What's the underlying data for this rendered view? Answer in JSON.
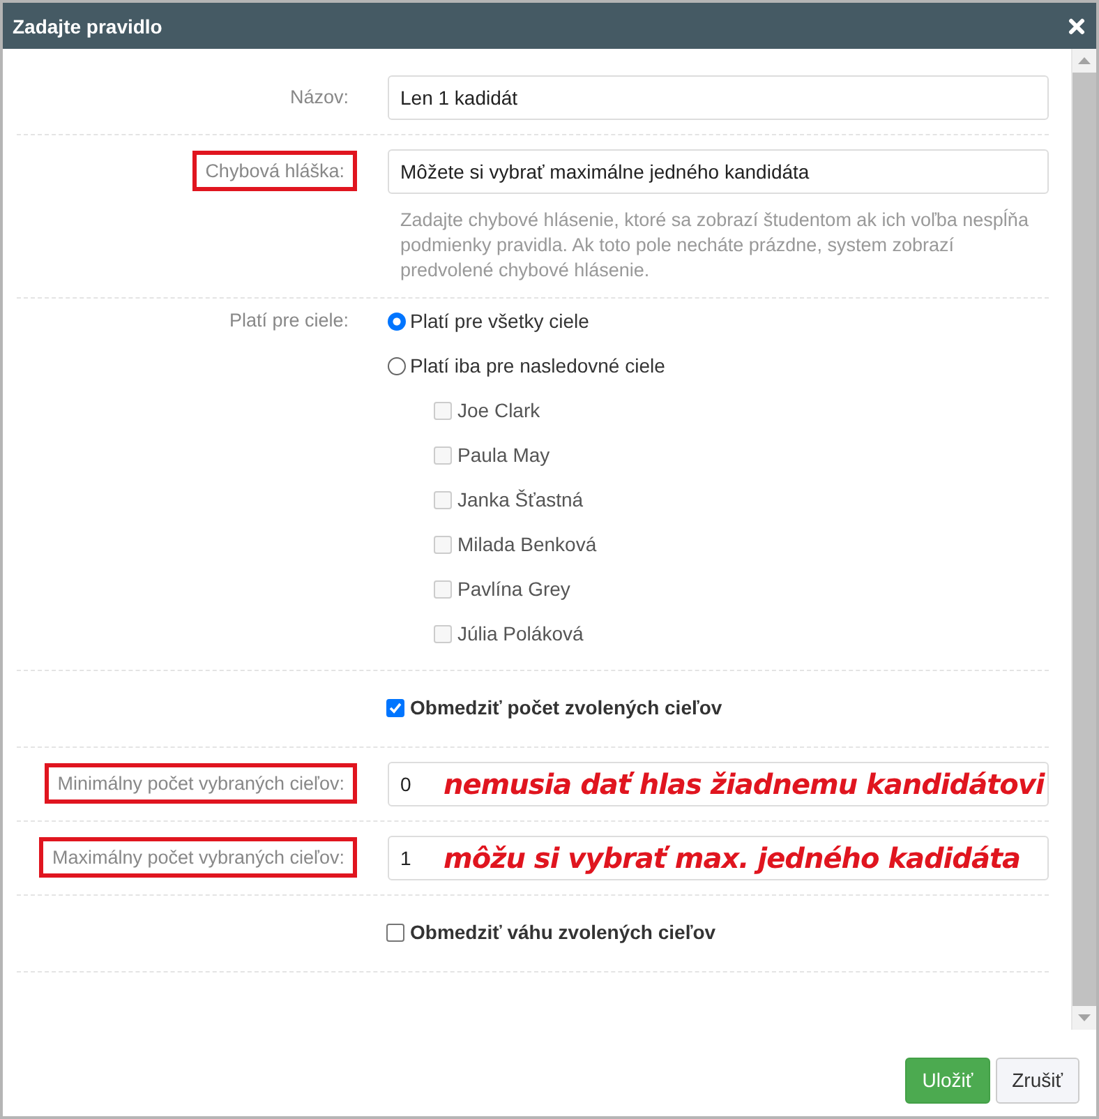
{
  "dialog": {
    "title": "Zadajte pravidlo"
  },
  "form": [
    {
      "kind": "text",
      "label": "Názov:",
      "value": "Len 1 kadidát",
      "highlighted": false
    },
    {
      "kind": "text",
      "label": "Chybová hláška:",
      "value": "Môžete si vybrať maximálne jedného kandidáta",
      "highlighted": true,
      "help": "Zadajte chybové hlásenie, ktoré sa zobrazí študentom ak ich voľba nespĺňa podmienky pravidla. Ak toto pole necháte prázdne, system zobrazí predvolené chybové hlásenie."
    },
    {
      "kind": "radios",
      "label": "Platí pre ciele:",
      "options": [
        {
          "label": "Platí pre všetky ciele",
          "selected": true
        },
        {
          "label": "Platí iba pre nasledovné ciele",
          "selected": false,
          "children": [
            {
              "label": "Joe Clark",
              "checked": false,
              "disabled": true
            },
            {
              "label": "Paula May",
              "checked": false,
              "disabled": true
            },
            {
              "label": "Janka Šťastná",
              "checked": false,
              "disabled": true
            },
            {
              "label": "Milada Benková",
              "checked": false,
              "disabled": true
            },
            {
              "label": "Pavlína Grey",
              "checked": false,
              "disabled": true
            },
            {
              "label": "Júlia Poláková",
              "checked": false,
              "disabled": true
            }
          ]
        }
      ]
    },
    {
      "kind": "checkbox",
      "label": "Obmedziť počet zvolených cieľov",
      "checked": true
    },
    {
      "kind": "text",
      "label": "Minimálny počet vybraných cieľov:",
      "value": "0",
      "highlighted": true,
      "annotation": "nemusia dať hlas žiadnemu kandidátovi"
    },
    {
      "kind": "text",
      "label": "Maximálny počet vybraných cieľov:",
      "value": "1",
      "highlighted": true,
      "annotation": "môžu si vybrať max. jedného kadidáta"
    },
    {
      "kind": "checkbox",
      "label": "Obmedziť váhu zvolených cieľov",
      "checked": false
    }
  ],
  "buttons": [
    {
      "label": "Uložiť",
      "kind": "primary"
    },
    {
      "label": "Zrušiť",
      "kind": "default"
    }
  ]
}
